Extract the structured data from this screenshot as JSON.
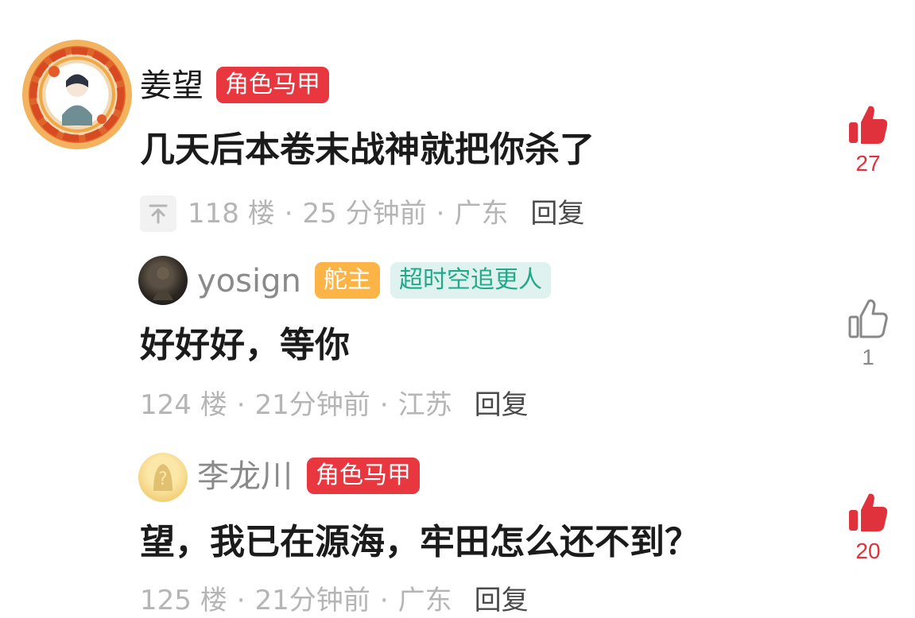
{
  "comments": [
    {
      "username": "姜望",
      "tags": [
        "角色马甲"
      ],
      "content": "几天后本卷末战神就把你杀了",
      "floor": "118 楼",
      "time": "25 分钟前",
      "location": "广东",
      "reply_label": "回复",
      "pinned": true,
      "likes": "27",
      "liked": true
    },
    {
      "username": "yosign",
      "tags": [
        "舵主",
        "超时空追更人"
      ],
      "content": "好好好，等你",
      "floor": "124 楼",
      "time": "21分钟前",
      "location": "江苏",
      "reply_label": "回复",
      "pinned": false,
      "likes": "1",
      "liked": false
    },
    {
      "username": "李龙川",
      "tags": [
        "角色马甲"
      ],
      "content": "望，我已在源海，牢田怎么还不到？",
      "floor": "125 楼",
      "time": "21分钟前",
      "location": "广东",
      "reply_label": "回复",
      "pinned": false,
      "likes": "20",
      "liked": true
    }
  ],
  "colors": {
    "like_active": "#e0323c",
    "like_inactive": "#888888",
    "tag_red": "#e8373f",
    "tag_orange": "#fbb445",
    "tag_teal_bg": "#dff2ef",
    "tag_teal_text": "#22a989",
    "meta_gray": "#b5b5b5"
  },
  "icons": {
    "like_active": "thumbs-up-filled-icon",
    "like_inactive": "thumbs-up-outline-icon",
    "pin": "pin-top-icon"
  }
}
